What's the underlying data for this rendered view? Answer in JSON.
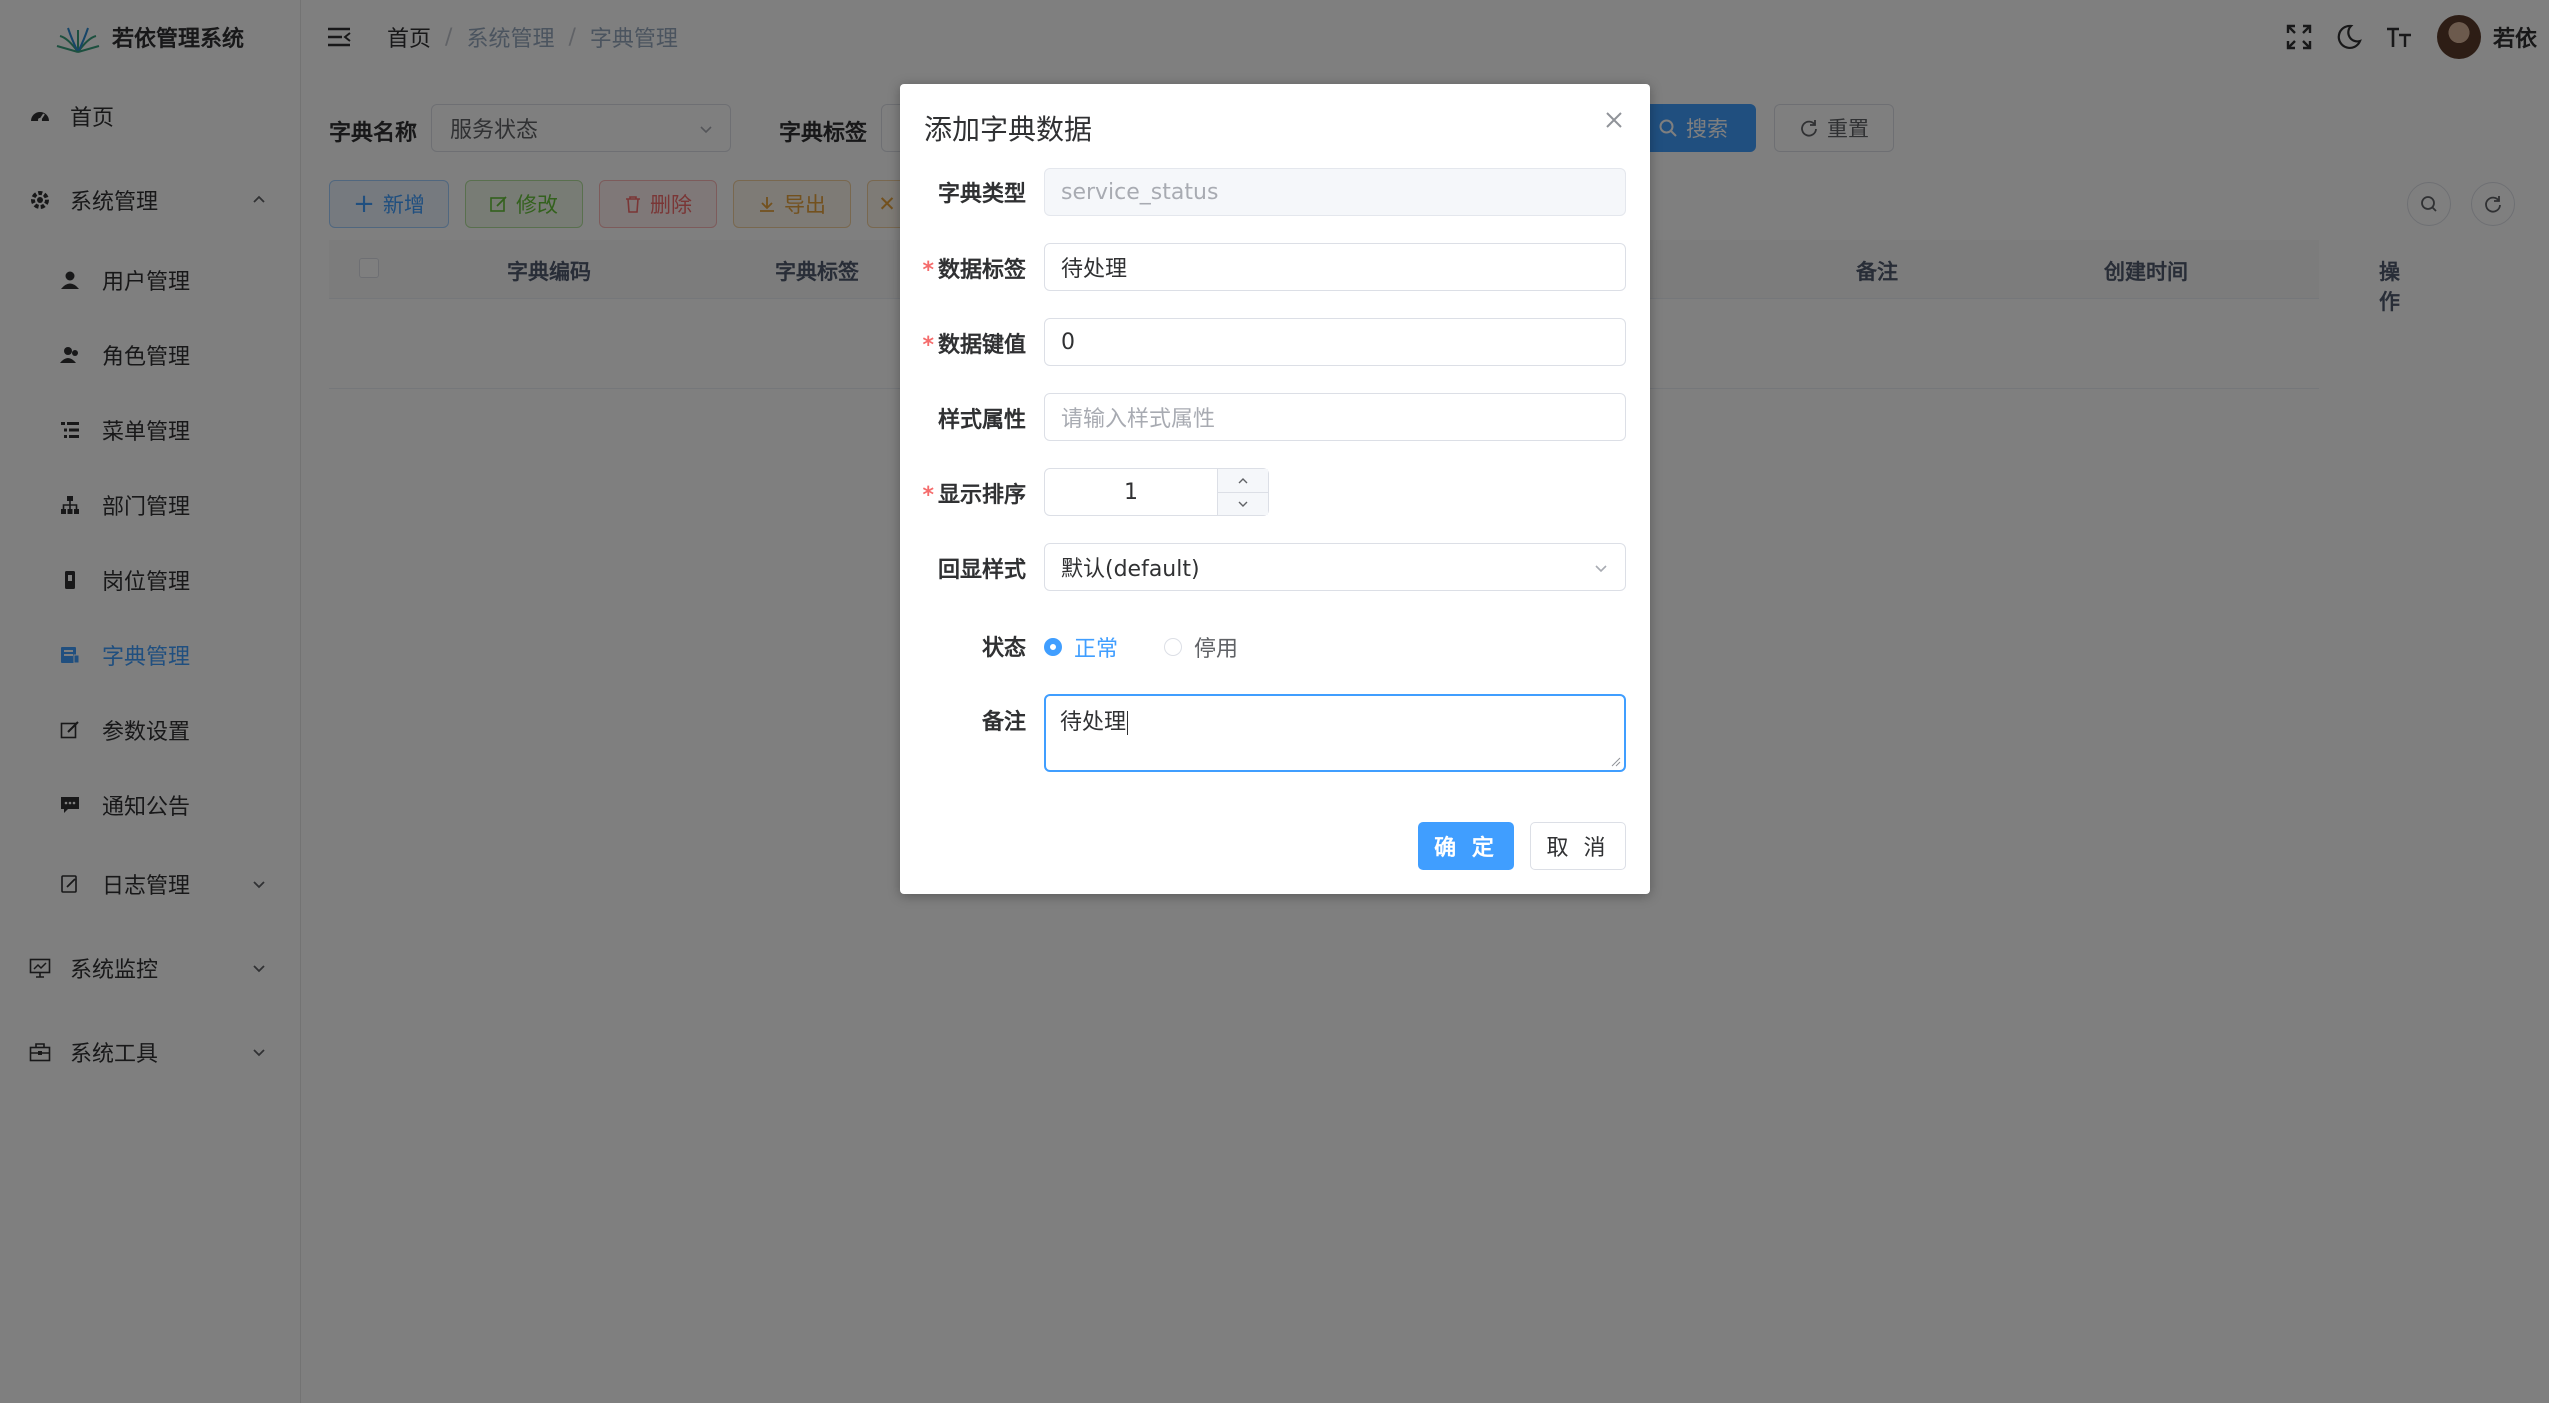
{
  "app": {
    "title": "若依管理系统"
  },
  "sidebar": {
    "items": [
      {
        "label": "首页",
        "icon": "dashboard-icon"
      },
      {
        "label": "系统管理",
        "icon": "gear-icon",
        "expanded": true
      },
      {
        "label": "用户管理",
        "icon": "user-icon"
      },
      {
        "label": "角色管理",
        "icon": "peoples-icon"
      },
      {
        "label": "菜单管理",
        "icon": "tree-table-icon"
      },
      {
        "label": "部门管理",
        "icon": "tree-icon"
      },
      {
        "label": "岗位管理",
        "icon": "post-icon"
      },
      {
        "label": "字典管理",
        "icon": "dict-icon",
        "active": true
      },
      {
        "label": "参数设置",
        "icon": "edit-icon"
      },
      {
        "label": "通知公告",
        "icon": "message-icon"
      },
      {
        "label": "日志管理",
        "icon": "log-icon"
      },
      {
        "label": "系统监控",
        "icon": "monitor-icon"
      },
      {
        "label": "系统工具",
        "icon": "tool-icon"
      }
    ]
  },
  "header": {
    "breadcrumb": [
      "首页",
      "系统管理",
      "字典管理"
    ],
    "username": "若依"
  },
  "query": {
    "dict_name_label": "字典名称",
    "dict_name_value": "服务状态",
    "dict_label_label": "字典标签",
    "search_label": "搜索",
    "reset_label": "重置"
  },
  "toolbar": {
    "add_label": "新增",
    "edit_label": "修改",
    "delete_label": "删除",
    "export_label": "导出"
  },
  "table": {
    "columns": [
      "字典编码",
      "字典标签",
      "备注",
      "创建时间",
      "操作"
    ]
  },
  "dialog": {
    "title": "添加字典数据",
    "fields": {
      "dict_type": {
        "label": "字典类型",
        "value": "service_status"
      },
      "dict_label": {
        "label": "数据标签",
        "value": "待处理"
      },
      "dict_value": {
        "label": "数据键值",
        "value": "0"
      },
      "css_class": {
        "label": "样式属性",
        "placeholder": "请输入样式属性"
      },
      "sort": {
        "label": "显示排序",
        "value": "1"
      },
      "list_class": {
        "label": "回显样式",
        "value": "默认(default)"
      },
      "status": {
        "label": "状态",
        "options": [
          "正常",
          "停用"
        ],
        "selected": "正常"
      },
      "remark": {
        "label": "备注",
        "value": "待处理"
      }
    },
    "confirm_label": "确 定",
    "cancel_label": "取 消"
  },
  "colors": {
    "primary": "#409eff",
    "success": "#67c23a",
    "danger": "#f56c6c",
    "warning": "#e6a23c",
    "required": "#f56c6c"
  }
}
